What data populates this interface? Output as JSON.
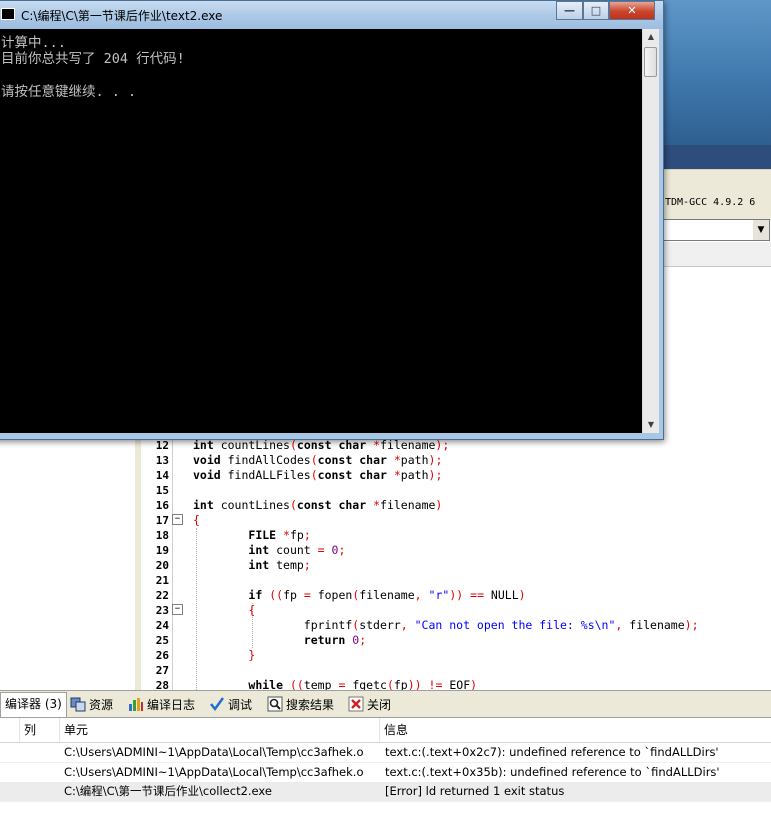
{
  "console_window": {
    "title": "C:\\编程\\C\\第一节课后作业\\text2.exe",
    "buttons": {
      "minimize": "—",
      "maximize": "□",
      "close": "✕"
    },
    "output_lines": [
      "计算中...",
      "目前你总共写了 204 行代码!",
      "",
      "请按任意键继续. . ."
    ]
  },
  "ide": {
    "compiler_label": "TDM-GCC 4.9.2 6",
    "combo_arrow": "▼"
  },
  "editor": {
    "lines": [
      {
        "n": "12",
        "fold": "",
        "text": "int countLines(const char *filename);"
      },
      {
        "n": "13",
        "fold": "",
        "text": "void findAllCodes(const char *path);"
      },
      {
        "n": "14",
        "fold": "",
        "text": "void findALLFiles(const char *path);"
      },
      {
        "n": "15",
        "fold": "",
        "text": ""
      },
      {
        "n": "16",
        "fold": "",
        "text": "int countLines(const char *filename)"
      },
      {
        "n": "17",
        "fold": "−",
        "text": "{"
      },
      {
        "n": "18",
        "fold": "",
        "text": "        FILE *fp;"
      },
      {
        "n": "19",
        "fold": "",
        "text": "        int count = 0;"
      },
      {
        "n": "20",
        "fold": "",
        "text": "        int temp;"
      },
      {
        "n": "21",
        "fold": "",
        "text": ""
      },
      {
        "n": "22",
        "fold": "",
        "text": "        if ((fp = fopen(filename, \"r\")) == NULL)"
      },
      {
        "n": "23",
        "fold": "−",
        "text": "        {"
      },
      {
        "n": "24",
        "fold": "",
        "text": "                fprintf(stderr, \"Can not open the file: %s\\n\", filename);"
      },
      {
        "n": "25",
        "fold": "",
        "text": "                return 0;"
      },
      {
        "n": "26",
        "fold": "",
        "text": "        }"
      },
      {
        "n": "27",
        "fold": "",
        "text": ""
      },
      {
        "n": "28",
        "fold": "",
        "text": "        while ((temp = fgetc(fp)) != EOF)"
      }
    ]
  },
  "tabs": [
    {
      "label": "编译器 (3)",
      "icon": "compiler-icon",
      "active": true
    },
    {
      "label": "资源",
      "icon": "resources-icon",
      "active": false
    },
    {
      "label": "编译日志",
      "icon": "compile-log-icon",
      "active": false
    },
    {
      "label": "调试",
      "icon": "debug-icon",
      "active": false
    },
    {
      "label": "搜索结果",
      "icon": "search-results-icon",
      "active": false
    },
    {
      "label": "关闭",
      "icon": "close-icon",
      "active": false
    }
  ],
  "messages": {
    "columns": [
      "列",
      "单元",
      "信息"
    ],
    "rows": [
      {
        "col": "",
        "unit": "C:\\Users\\ADMINI~1\\AppData\\Local\\Temp\\cc3afhek.o",
        "info": "text.c:(.text+0x2c7): undefined reference to `findALLDirs'"
      },
      {
        "col": "",
        "unit": "C:\\Users\\ADMINI~1\\AppData\\Local\\Temp\\cc3afhek.o",
        "info": "text.c:(.text+0x35b): undefined reference to `findALLDirs'"
      },
      {
        "col": "",
        "unit": "C:\\编程\\C\\第一节课后作业\\collect2.exe",
        "info": "[Error] ld returned 1 exit status"
      }
    ]
  },
  "colors": {
    "console_bg": "#000000",
    "console_text": "#c0c0c0",
    "keyword": "#000000",
    "operator": "#e00000",
    "string": "#0000ff",
    "number": "#800080",
    "close_button": "#c9452c"
  }
}
